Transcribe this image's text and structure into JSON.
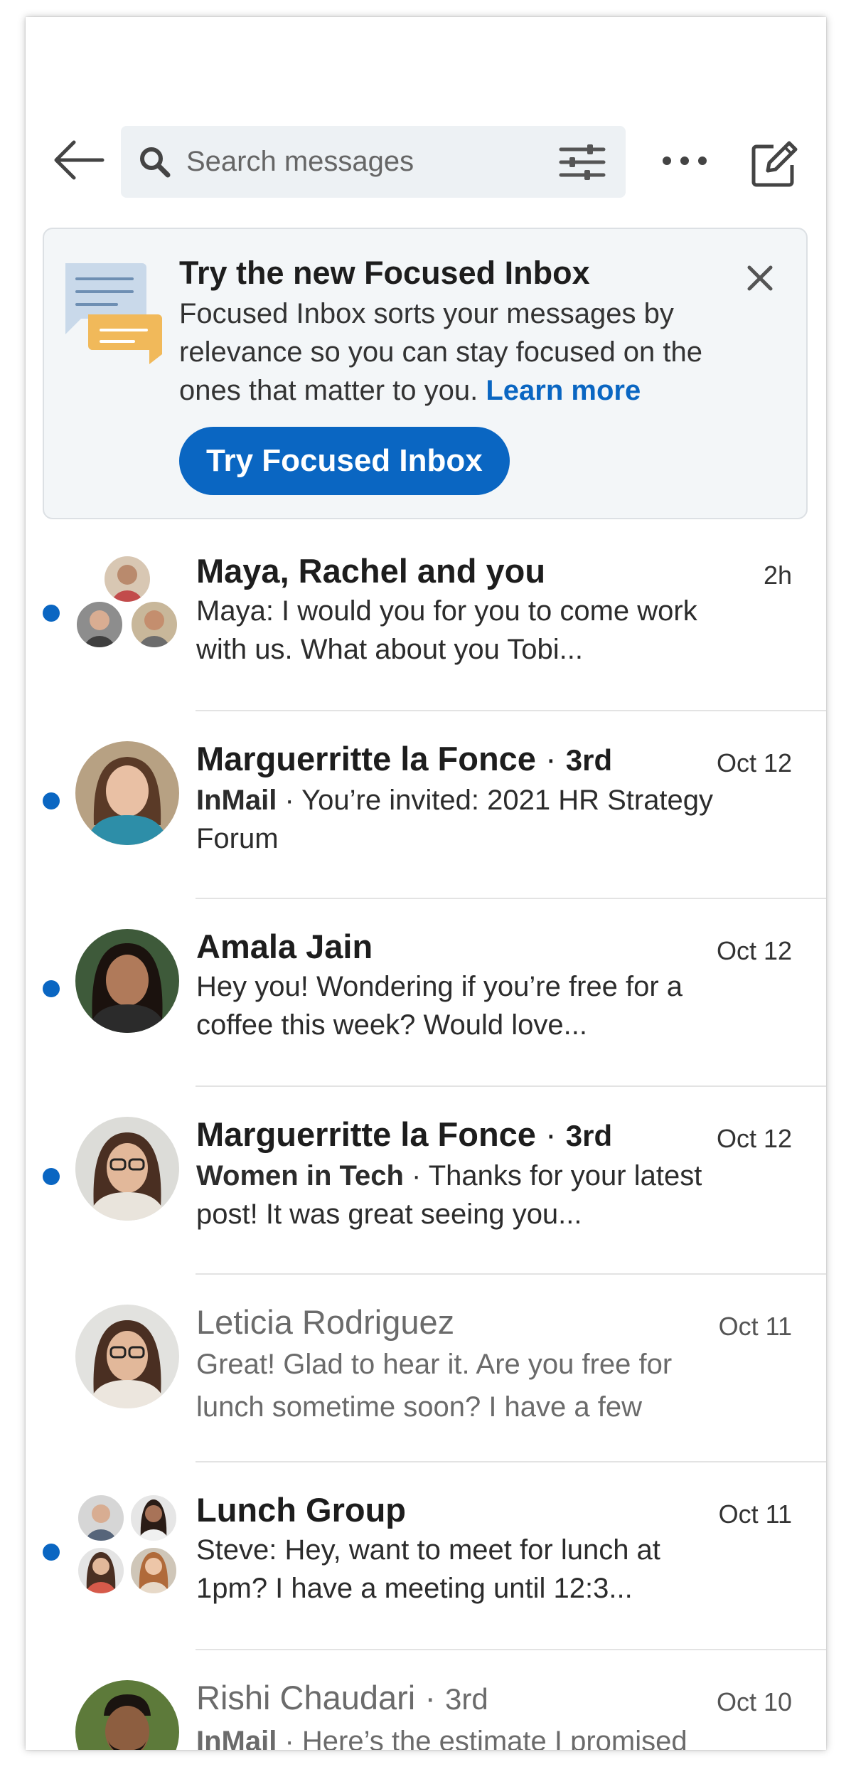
{
  "header": {
    "search_placeholder": "Search messages"
  },
  "banner": {
    "title": "Try the new Focused Inbox",
    "body": "Focused Inbox sorts your messages by relevance so you can stay focused on the ones that matter to you.",
    "learn_more": "Learn more",
    "cta": "Try Focused Inbox"
  },
  "colors": {
    "accent": "#0a66c2",
    "banner_bg": "#f3f6f8",
    "search_bg": "#edf1f4"
  },
  "conversations": [
    {
      "name": "Maya, Rachel and you",
      "degree": "",
      "sender": "",
      "preview": "Maya: I would you for you to come work with us. What about you Tobi...",
      "time": "2h",
      "unread": true,
      "avatar": "group-3"
    },
    {
      "name": "Marguerritte la Fonce",
      "degree": "3rd",
      "sender": "InMail",
      "preview": "You’re invited: 2021 HR Strategy Forum",
      "time": "Oct 12",
      "unread": true,
      "avatar": "single"
    },
    {
      "name": "Amala Jain",
      "degree": "",
      "sender": "",
      "preview": "Hey you! Wondering if you’re free for a coffee this week? Would love...",
      "time": "Oct 12",
      "unread": true,
      "avatar": "single"
    },
    {
      "name": "Marguerritte la Fonce",
      "degree": "3rd",
      "sender": "Women in Tech",
      "preview": "Thanks for your latest post! It was great seeing you...",
      "time": "Oct 12",
      "unread": true,
      "avatar": "single"
    },
    {
      "name": "Leticia Rodriguez",
      "degree": "",
      "sender": "",
      "preview": "Great! Glad to hear it. Are you free for lunch sometime soon? I have a few",
      "time": "Oct 11",
      "unread": false,
      "avatar": "single"
    },
    {
      "name": "Lunch Group",
      "degree": "",
      "sender": "",
      "preview": "Steve: Hey, want to meet for lunch at 1pm? I have a meeting until 12:3...",
      "time": "Oct 11",
      "unread": true,
      "avatar": "group-4"
    },
    {
      "name": "Rishi Chaudari",
      "degree": "3rd",
      "sender": "InMail",
      "preview": "Here’s the estimate I promised",
      "time": "Oct 10",
      "unread": false,
      "avatar": "single"
    }
  ]
}
